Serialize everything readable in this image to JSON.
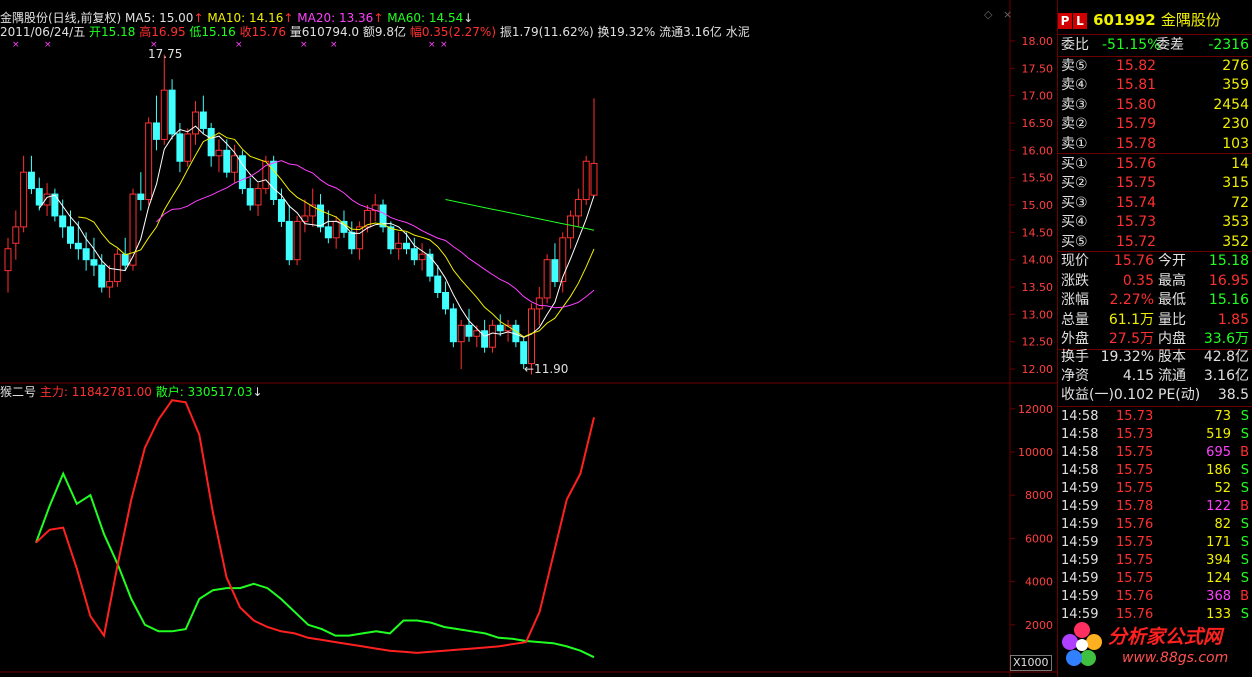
{
  "header": {
    "stock": "金隅股份(日线,前复权)",
    "ma5": "MA5: 15.00",
    "ma10": "MA10: 14.16",
    "ma20": "MA20: 13.36",
    "ma60": "MA60: 14.54",
    "date": "2011/06/24/五",
    "open": "开15.18",
    "high": "高16.95",
    "low": "低15.16",
    "close": "收15.76",
    "vol": "量610794.0",
    "amount": "额9.8亿",
    "range": "幅0.35(2.27%)",
    "amp": "振1.79(11.62%)",
    "turn": "换19.32%",
    "float": "流通3.16亿",
    "sector": "水泥"
  },
  "annotations": {
    "max_label": "17.75",
    "min_label": "←11.90"
  },
  "indicator": {
    "name": "猴二号",
    "main": "主力: 11842781.00",
    "retail": "散户: 330517.03"
  },
  "price_axis": [
    "18.00",
    "17.50",
    "17.00",
    "16.50",
    "16.00",
    "15.50",
    "15.00",
    "14.50",
    "14.00",
    "13.50",
    "13.00",
    "12.50",
    "12.00"
  ],
  "ind_axis": [
    "12000",
    "10000",
    "8000",
    "6000",
    "4000",
    "2000"
  ],
  "ind_unit": "X1000",
  "quote": {
    "code": "601992",
    "name": "金隅股份",
    "webi_label": "委比",
    "webi": "-51.15%",
    "weicha_label": "委差",
    "weicha": "-2316",
    "asks": [
      {
        "label": "卖⑤",
        "price": "15.82",
        "vol": "276"
      },
      {
        "label": "卖④",
        "price": "15.81",
        "vol": "359"
      },
      {
        "label": "卖③",
        "price": "15.80",
        "vol": "2454"
      },
      {
        "label": "卖②",
        "price": "15.79",
        "vol": "230"
      },
      {
        "label": "卖①",
        "price": "15.78",
        "vol": "103"
      }
    ],
    "bids": [
      {
        "label": "买①",
        "price": "15.76",
        "vol": "14"
      },
      {
        "label": "买②",
        "price": "15.75",
        "vol": "315"
      },
      {
        "label": "买③",
        "price": "15.74",
        "vol": "72"
      },
      {
        "label": "买④",
        "price": "15.73",
        "vol": "353"
      },
      {
        "label": "买⑤",
        "price": "15.72",
        "vol": "352"
      }
    ],
    "stats": [
      {
        "l1": "现价",
        "v1": "15.76",
        "l2": "今开",
        "v2": "15.18"
      },
      {
        "l1": "涨跌",
        "v1": "0.35",
        "l2": "最高",
        "v2": "16.95"
      },
      {
        "l1": "涨幅",
        "v1": "2.27%",
        "l2": "最低",
        "v2": "15.16"
      },
      {
        "l1": "总量",
        "v1": "61.1万",
        "l2": "量比",
        "v2": "1.85"
      },
      {
        "l1": "外盘",
        "v1": "27.5万",
        "l2": "内盘",
        "v2": "33.6万"
      }
    ],
    "fund": [
      {
        "l1": "换手",
        "v1": "19.32%",
        "l2": "股本",
        "v2": "42.8亿"
      },
      {
        "l1": "净资",
        "v1": "4.15",
        "l2": "流通",
        "v2": "3.16亿"
      },
      {
        "l1": "收益(一)",
        "v1": "0.102",
        "l2": "PE(动)",
        "v2": "38.5"
      }
    ],
    "ticks": [
      {
        "t": "14:58",
        "p": "15.73",
        "v": "73",
        "d": "S"
      },
      {
        "t": "14:58",
        "p": "15.73",
        "v": "519",
        "d": "S"
      },
      {
        "t": "14:58",
        "p": "15.75",
        "v": "695",
        "d": "B"
      },
      {
        "t": "14:58",
        "p": "15.75",
        "v": "186",
        "d": "S"
      },
      {
        "t": "14:59",
        "p": "15.75",
        "v": "52",
        "d": "S"
      },
      {
        "t": "14:59",
        "p": "15.78",
        "v": "122",
        "d": "B"
      },
      {
        "t": "14:59",
        "p": "15.76",
        "v": "82",
        "d": "S"
      },
      {
        "t": "14:59",
        "p": "15.75",
        "v": "171",
        "d": "S"
      },
      {
        "t": "14:59",
        "p": "15.75",
        "v": "394",
        "d": "S"
      },
      {
        "t": "14:59",
        "p": "15.75",
        "v": "124",
        "d": "S"
      },
      {
        "t": "14:59",
        "p": "15.76",
        "v": "368",
        "d": "B"
      },
      {
        "t": "14:59",
        "p": "15.76",
        "v": "133",
        "d": "S"
      }
    ]
  },
  "watermark": {
    "title": "分析家公式网",
    "url": "www.88gs.com"
  },
  "colors": {
    "up": "#ff3030",
    "down": "#40ffff",
    "ma5": "#ffffff",
    "ma10": "#f0f000",
    "ma20": "#ff40ff",
    "ma60": "#20ff20",
    "main": "#ff2020",
    "retail": "#20ff20"
  },
  "chart_data": {
    "type": "candlestick",
    "price_range": [
      11.8,
      18.2
    ],
    "candles": [
      [
        13.8,
        14.4,
        13.4,
        14.2
      ],
      [
        14.3,
        14.9,
        14.0,
        14.6
      ],
      [
        14.6,
        15.9,
        14.5,
        15.6
      ],
      [
        15.6,
        15.9,
        15.2,
        15.3
      ],
      [
        15.3,
        15.5,
        14.9,
        15.0
      ],
      [
        15.0,
        15.4,
        14.8,
        15.2
      ],
      [
        15.2,
        15.3,
        14.7,
        14.8
      ],
      [
        14.8,
        15.1,
        14.4,
        14.6
      ],
      [
        14.6,
        14.9,
        14.2,
        14.3
      ],
      [
        14.3,
        14.7,
        14.0,
        14.2
      ],
      [
        14.2,
        14.5,
        13.8,
        14.0
      ],
      [
        14.0,
        14.4,
        13.7,
        13.9
      ],
      [
        13.9,
        14.1,
        13.4,
        13.5
      ],
      [
        13.5,
        13.9,
        13.3,
        13.6
      ],
      [
        13.6,
        14.2,
        13.5,
        14.1
      ],
      [
        14.1,
        14.4,
        13.8,
        13.9
      ],
      [
        13.9,
        15.3,
        13.8,
        15.2
      ],
      [
        15.2,
        15.6,
        14.9,
        15.1
      ],
      [
        15.1,
        16.6,
        15.0,
        16.5
      ],
      [
        16.5,
        17.0,
        16.0,
        16.2
      ],
      [
        16.2,
        17.75,
        16.1,
        17.1
      ],
      [
        17.1,
        17.3,
        16.2,
        16.3
      ],
      [
        16.3,
        16.5,
        15.6,
        15.8
      ],
      [
        15.8,
        16.4,
        15.7,
        16.3
      ],
      [
        16.3,
        16.9,
        16.1,
        16.7
      ],
      [
        16.7,
        17.0,
        16.3,
        16.4
      ],
      [
        16.4,
        16.5,
        15.7,
        15.9
      ],
      [
        15.9,
        16.2,
        15.6,
        16.0
      ],
      [
        16.0,
        16.2,
        15.5,
        15.6
      ],
      [
        15.6,
        16.1,
        15.4,
        15.9
      ],
      [
        15.9,
        16.0,
        15.2,
        15.3
      ],
      [
        15.3,
        15.5,
        14.9,
        15.0
      ],
      [
        15.0,
        15.4,
        14.8,
        15.3
      ],
      [
        15.3,
        15.9,
        15.2,
        15.8
      ],
      [
        15.8,
        15.9,
        15.0,
        15.1
      ],
      [
        15.1,
        15.3,
        14.6,
        14.7
      ],
      [
        14.7,
        15.0,
        13.9,
        14.0
      ],
      [
        14.0,
        14.8,
        13.9,
        14.7
      ],
      [
        14.7,
        15.1,
        14.5,
        14.8
      ],
      [
        14.8,
        15.3,
        14.6,
        15.0
      ],
      [
        15.0,
        15.2,
        14.5,
        14.6
      ],
      [
        14.6,
        14.9,
        14.3,
        14.4
      ],
      [
        14.4,
        14.8,
        14.2,
        14.7
      ],
      [
        14.7,
        14.9,
        14.4,
        14.5
      ],
      [
        14.5,
        14.7,
        14.1,
        14.2
      ],
      [
        14.2,
        14.7,
        14.0,
        14.6
      ],
      [
        14.6,
        15.0,
        14.5,
        14.9
      ],
      [
        14.9,
        15.2,
        14.7,
        15.0
      ],
      [
        15.0,
        15.1,
        14.5,
        14.6
      ],
      [
        14.6,
        14.7,
        14.1,
        14.2
      ],
      [
        14.2,
        14.5,
        14.0,
        14.3
      ],
      [
        14.3,
        14.5,
        14.1,
        14.2
      ],
      [
        14.2,
        14.4,
        13.9,
        14.0
      ],
      [
        14.0,
        14.3,
        13.8,
        14.1
      ],
      [
        14.1,
        14.2,
        13.6,
        13.7
      ],
      [
        13.7,
        13.9,
        13.3,
        13.4
      ],
      [
        13.4,
        13.6,
        13.0,
        13.1
      ],
      [
        13.1,
        13.2,
        12.4,
        12.5
      ],
      [
        12.5,
        12.9,
        12.0,
        12.8
      ],
      [
        12.8,
        13.1,
        12.5,
        12.6
      ],
      [
        12.6,
        12.8,
        12.4,
        12.7
      ],
      [
        12.7,
        12.9,
        12.3,
        12.4
      ],
      [
        12.4,
        12.9,
        12.3,
        12.8
      ],
      [
        12.8,
        13.0,
        12.6,
        12.7
      ],
      [
        12.7,
        12.9,
        12.5,
        12.8
      ],
      [
        12.8,
        12.9,
        12.4,
        12.5
      ],
      [
        12.5,
        12.6,
        12.0,
        12.1
      ],
      [
        12.1,
        13.2,
        11.9,
        13.1
      ],
      [
        13.1,
        13.5,
        12.8,
        13.3
      ],
      [
        13.3,
        14.1,
        13.2,
        14.0
      ],
      [
        14.0,
        14.3,
        13.5,
        13.6
      ],
      [
        13.6,
        14.5,
        13.4,
        14.4
      ],
      [
        14.4,
        14.9,
        14.2,
        14.8
      ],
      [
        14.8,
        15.3,
        14.6,
        15.1
      ],
      [
        15.1,
        15.9,
        15.0,
        15.8
      ],
      [
        15.18,
        16.95,
        15.16,
        15.76
      ]
    ],
    "ma5_end": 15.0,
    "ma10_end": 14.16,
    "ma20_end": 13.36,
    "ma60_end": 14.54,
    "indicator_range": [
      0,
      12500
    ],
    "main_series": [
      5800,
      6400,
      6500,
      4600,
      2400,
      1500,
      4800,
      7800,
      10200,
      11500,
      12400,
      12300,
      10800,
      7200,
      4200,
      2800,
      2200,
      1900,
      1700,
      1600,
      1400,
      1300,
      1200,
      1100,
      1000,
      900,
      800,
      750,
      700,
      750,
      800,
      850,
      900,
      950,
      1000,
      1100,
      1200,
      2600,
      5200,
      7800,
      9000,
      11600
    ],
    "retail_series": [
      5800,
      7500,
      9000,
      7600,
      8000,
      6200,
      4800,
      3200,
      2000,
      1700,
      1700,
      1800,
      3200,
      3600,
      3700,
      3700,
      3900,
      3700,
      3200,
      2600,
      2000,
      1800,
      1500,
      1500,
      1600,
      1700,
      1600,
      2200,
      2200,
      2100,
      1900,
      1800,
      1700,
      1600,
      1400,
      1350,
      1250,
      1200,
      1150,
      1000,
      800,
      500
    ]
  }
}
